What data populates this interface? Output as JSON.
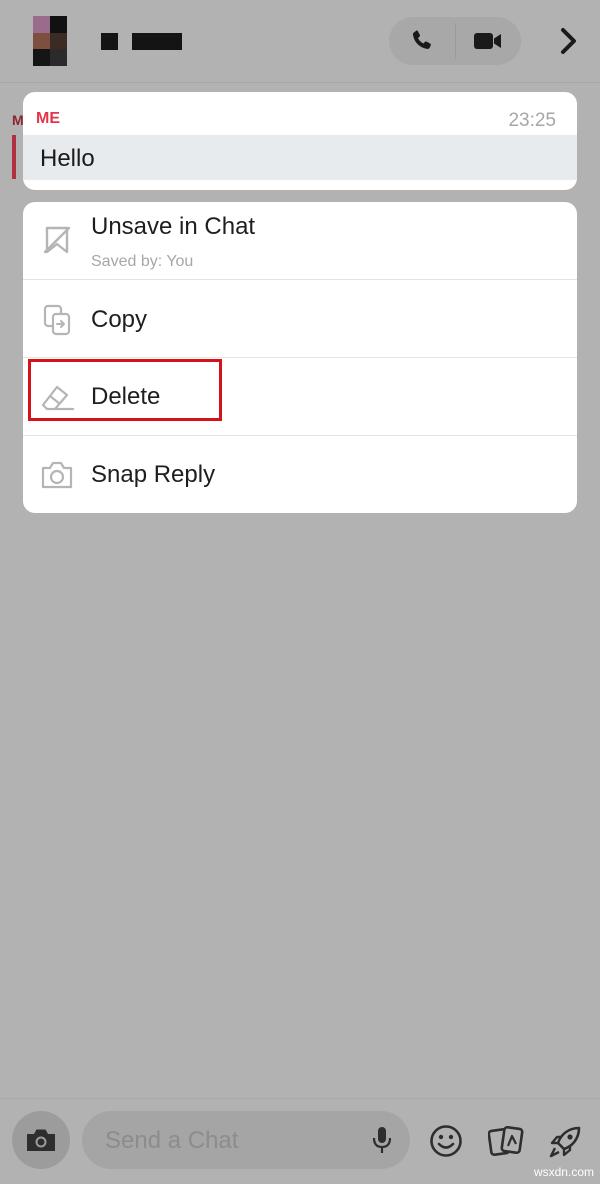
{
  "header": {
    "avatar_colors": [
      "#9a6c8c",
      "#111111",
      "#7d4f3e",
      "#3c2a24",
      "#151515",
      "#2b2b2b"
    ],
    "call_icon": "phone-icon",
    "video_icon": "video-camera-icon",
    "chevron_icon": "chevron-right-icon"
  },
  "message": {
    "sender": "ME",
    "time": "23:25",
    "text": "Hello",
    "accent_color": "#e0354b"
  },
  "menu": {
    "items": [
      {
        "label": "Unsave in Chat",
        "sublabel": "Saved by: You",
        "icon": "unsave-bookmark-icon"
      },
      {
        "label": "Copy",
        "icon": "copy-icon"
      },
      {
        "label": "Delete",
        "icon": "eraser-icon"
      },
      {
        "label": "Snap Reply",
        "icon": "camera-icon"
      }
    ],
    "highlight_color": "#d4121b"
  },
  "bottom_bar": {
    "input_placeholder": "Send a Chat",
    "camera_icon": "camera-icon",
    "mic_icon": "microphone-icon",
    "emoji_icon": "smiley-icon",
    "sticker_icon": "sticker-cards-icon",
    "games_icon": "rocket-icon"
  },
  "watermark": "wsxdn.com"
}
